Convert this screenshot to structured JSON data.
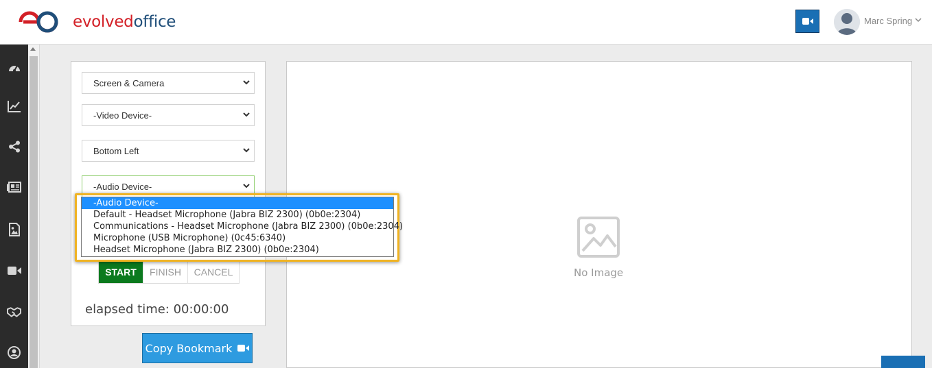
{
  "app": {
    "logo_evolved": "evolved",
    "logo_office": "office"
  },
  "header": {
    "user_name": "Marc Spring",
    "accent_color": "#1a6fb4"
  },
  "sidebar": {
    "icons": [
      "dashboard-icon",
      "analytics-icon",
      "share-icon",
      "newspaper-icon",
      "image-file-icon",
      "video-camera-icon",
      "handshake-icon",
      "user-circle-icon"
    ]
  },
  "recorder": {
    "mode_select": "Screen & Camera",
    "video_device_select": "-Video Device-",
    "position_select": "Bottom Left",
    "audio_device_select": "-Audio Device-",
    "audio_options": [
      "-Audio Device-",
      "Default - Headset Microphone (Jabra BIZ 2300) (0b0e:2304)",
      "Communications - Headset Microphone (Jabra BIZ 2300) (0b0e:2304)",
      "Microphone (USB Microphone) (0c45:6340)",
      "Headset Microphone (Jabra BIZ 2300) (0b0e:2304)"
    ],
    "selected_option_index": 0,
    "start_label": "START",
    "finish_label": "FINISH",
    "cancel_label": "CANCEL",
    "elapsed_label": "elapsed time: 00:00:00",
    "bookmark_label": "Copy Bookmark"
  },
  "preview": {
    "no_image_label": "No Image"
  }
}
